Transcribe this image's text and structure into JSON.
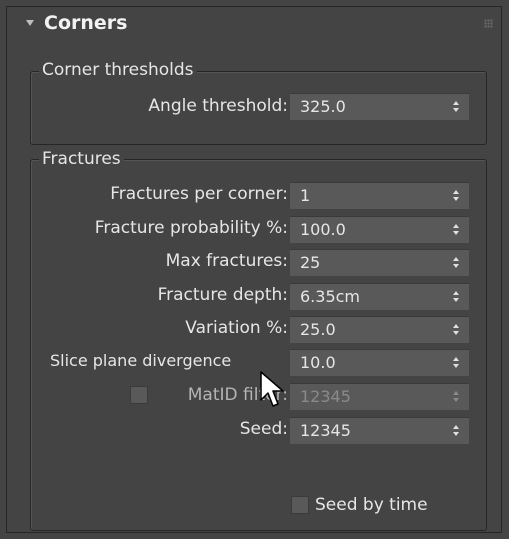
{
  "panel": {
    "title": "Corners"
  },
  "corner_thresholds": {
    "legend": "Corner thresholds",
    "angle_threshold": {
      "label": "Angle threshold:",
      "value": "325.0"
    }
  },
  "fractures": {
    "legend": "Fractures",
    "fractures_per_corner": {
      "label": "Fractures per corner:",
      "value": "1"
    },
    "fracture_probability": {
      "label": "Fracture probability %:",
      "value": "100.0"
    },
    "max_fractures": {
      "label": "Max fractures:",
      "value": "25"
    },
    "fracture_depth": {
      "label": "Fracture depth:",
      "value": "6.35cm"
    },
    "variation": {
      "label": "Variation %:",
      "value": "25.0"
    },
    "slice_plane_divergence": {
      "label": "Slice plane divergence",
      "value": "10.0"
    },
    "matid_filter": {
      "label": "MatID filter:",
      "value": "12345",
      "checked": false,
      "enabled": false
    },
    "seed": {
      "label": "Seed:",
      "value": "12345"
    },
    "seed_by_time": {
      "label": "Seed by time",
      "checked": false
    }
  },
  "colors": {
    "panel_bg": "#444444",
    "field_bg": "#595959",
    "text": "#e6e6e6",
    "border": "#262626"
  },
  "icons": [
    "collapse-triangle-icon",
    "grip-dots-icon",
    "spinner-arrows-icon",
    "mouse-pointer-icon"
  ]
}
